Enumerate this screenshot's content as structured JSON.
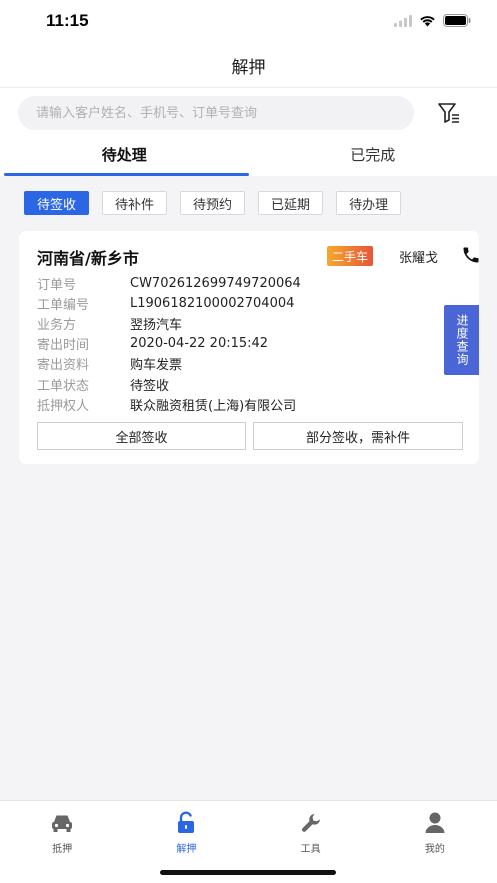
{
  "status_bar": {
    "time": "11:15"
  },
  "nav": {
    "title": "解押"
  },
  "search": {
    "placeholder": "请输入客户姓名、手机号、订单号查询"
  },
  "tabs": [
    {
      "label": "待处理",
      "active": true
    },
    {
      "label": "已完成",
      "active": false
    }
  ],
  "filters": [
    {
      "label": "待签收",
      "active": true
    },
    {
      "label": "待补件",
      "active": false
    },
    {
      "label": "待预约",
      "active": false
    },
    {
      "label": "已延期",
      "active": false
    },
    {
      "label": "待办理",
      "active": false
    }
  ],
  "card": {
    "region": "河南省/新乡市",
    "badge": "二手车",
    "contact": "张耀戈",
    "rows": [
      {
        "label": "订单号",
        "value": "CW702612699749720064"
      },
      {
        "label": "工单编号",
        "value": "L1906182100002704004"
      },
      {
        "label": "业务方",
        "value": "翌扬汽车"
      },
      {
        "label": "寄出时间",
        "value": "2020-04-22 20:15:42"
      },
      {
        "label": "寄出资料",
        "value": "购车发票"
      },
      {
        "label": "工单状态",
        "value": "待签收"
      },
      {
        "label": "抵押权人",
        "value": "联众融资租赁(上海)有限公司"
      }
    ],
    "actions": {
      "sign_all": "全部签收",
      "sign_partial": "部分签收，需补件"
    }
  },
  "progress_tab": "进度查询",
  "tabbar": [
    {
      "label": "抵押",
      "icon": "car-icon",
      "active": false
    },
    {
      "label": "解押",
      "icon": "unlock-icon",
      "active": true
    },
    {
      "label": "工具",
      "icon": "wrench-icon",
      "active": false
    },
    {
      "label": "我的",
      "icon": "user-icon",
      "active": false
    }
  ],
  "colors": {
    "accent": "#2b67e4",
    "badge_start": "#f7a82c",
    "badge_end": "#e8543a",
    "progress_tab": "#4a66d6"
  }
}
